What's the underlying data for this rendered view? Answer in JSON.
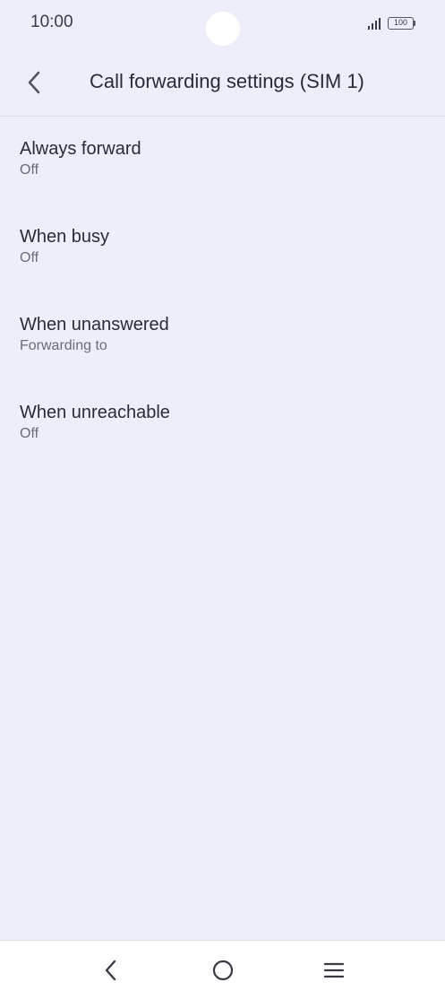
{
  "status_bar": {
    "time": "10:00",
    "battery_level": "100",
    "icons": [
      "signal-icon",
      "battery-icon"
    ]
  },
  "app_bar": {
    "title": "Call forwarding settings (SIM 1)",
    "back_icon": "back-arrow-icon"
  },
  "settings": {
    "items": [
      {
        "title": "Always forward",
        "subtitle": "Off"
      },
      {
        "title": "When busy",
        "subtitle": "Off"
      },
      {
        "title": "When unanswered",
        "subtitle": "Forwarding to"
      },
      {
        "title": "When unreachable",
        "subtitle": "Off"
      }
    ]
  },
  "nav_bar": {
    "icons": [
      "nav-back-icon",
      "home-icon",
      "recents-menu-icon"
    ]
  },
  "colors": {
    "background": "#eeeefa",
    "nav_background": "#ffffff",
    "text_primary": "#2b2b33",
    "text_secondary": "#6c6c76"
  }
}
